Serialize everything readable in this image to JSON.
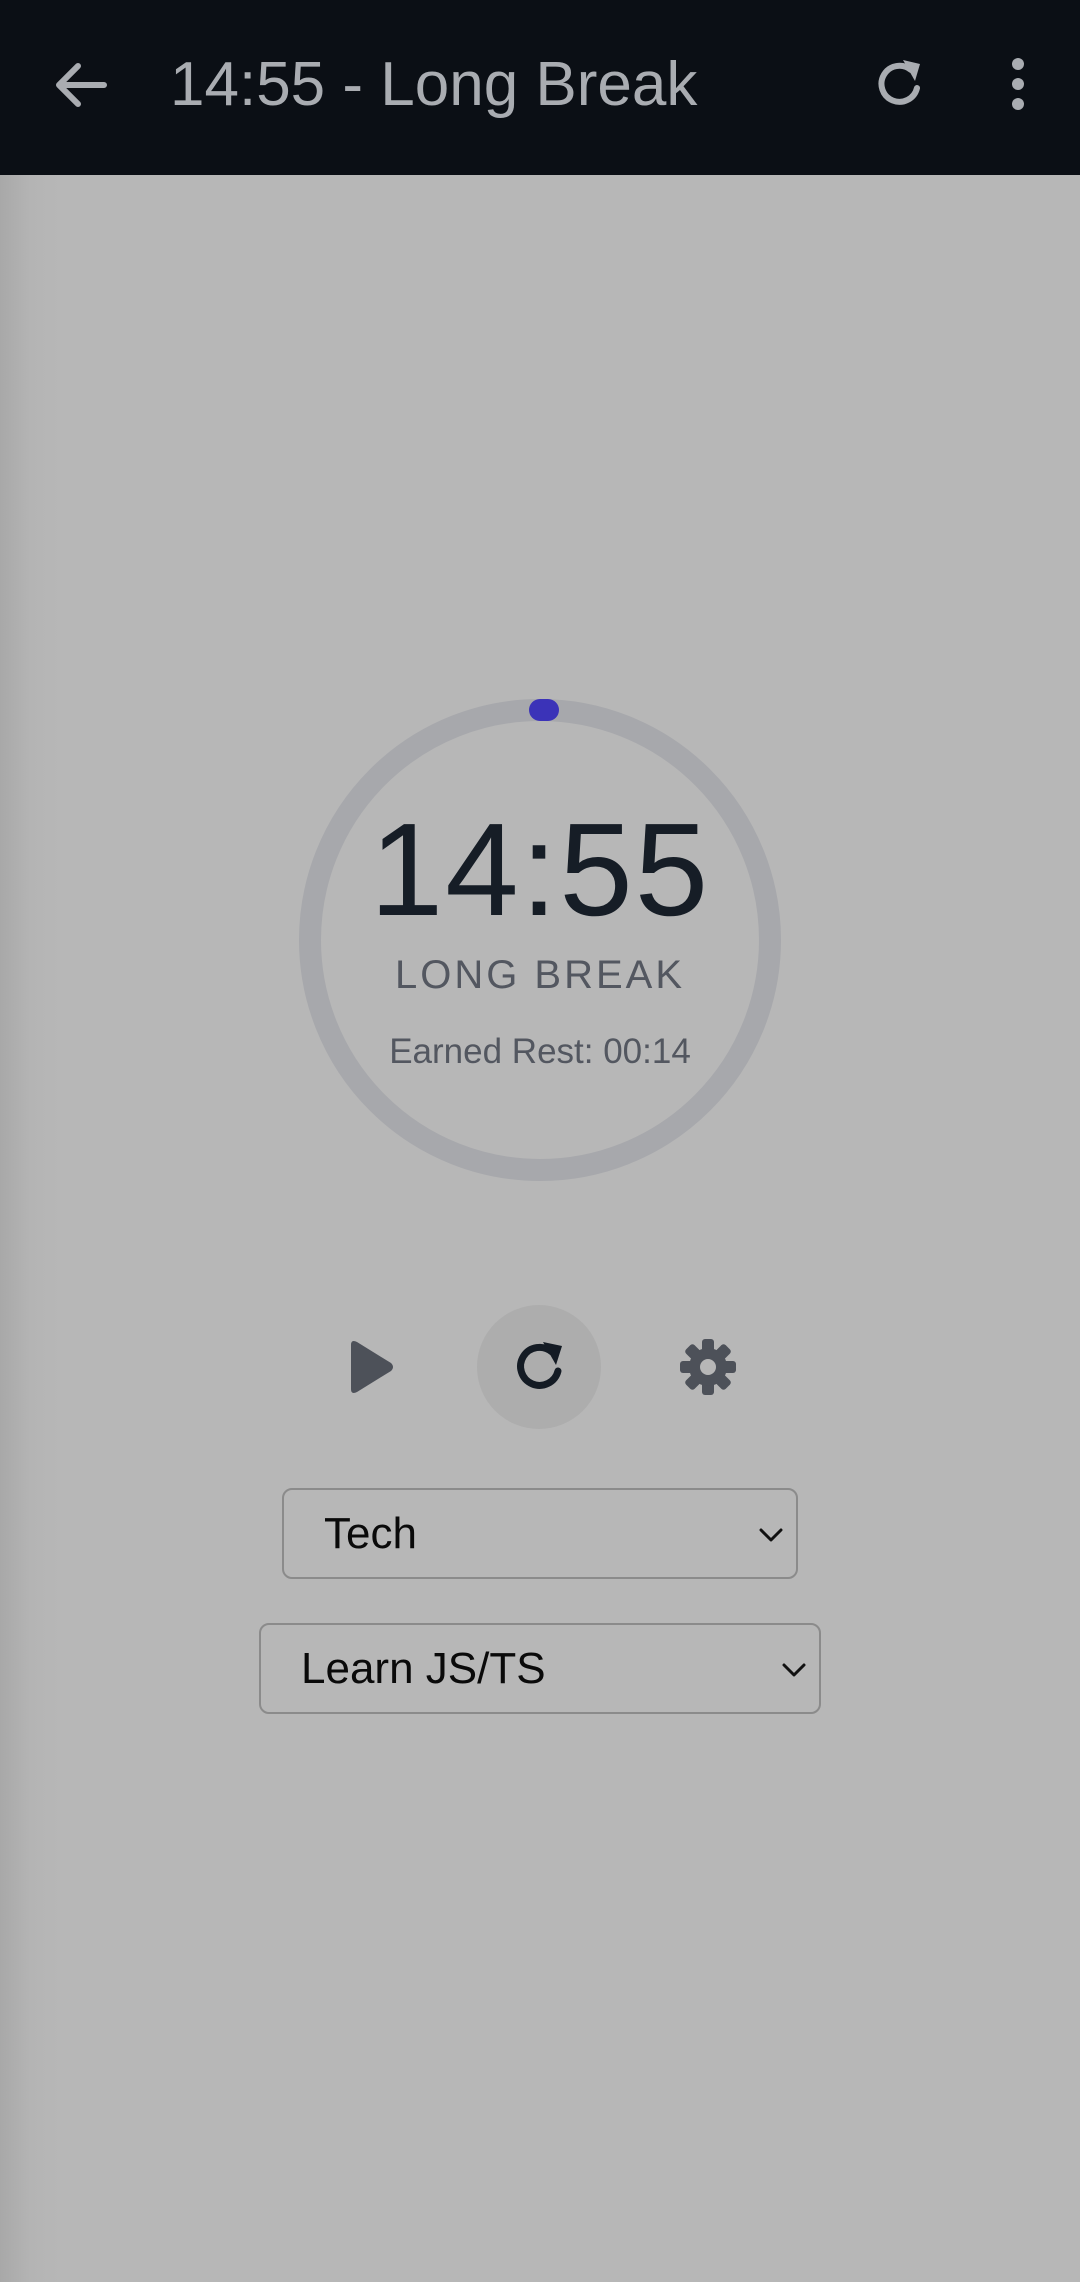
{
  "appbar": {
    "title": "14:55 - Long Break",
    "back_icon": "arrow-left-icon",
    "reload_icon": "reload-icon",
    "more_icon": "more-vertical-icon"
  },
  "timer": {
    "time": "14:55",
    "mode": "LONG BREAK",
    "earned_rest": "Earned Rest: 00:14",
    "progress": 0.0,
    "ring_color": "#a7a8ac",
    "progress_color": "#3b33b8"
  },
  "controls": {
    "play_icon": "play-icon",
    "reset_icon": "reset-icon",
    "settings_icon": "gear-icon"
  },
  "selects": {
    "category": {
      "value": "Tech"
    },
    "project": {
      "value": "Learn JS/TS"
    }
  },
  "colors": {
    "appbar_bg": "#0b0f15",
    "page_bg": "#b7b7b7"
  }
}
